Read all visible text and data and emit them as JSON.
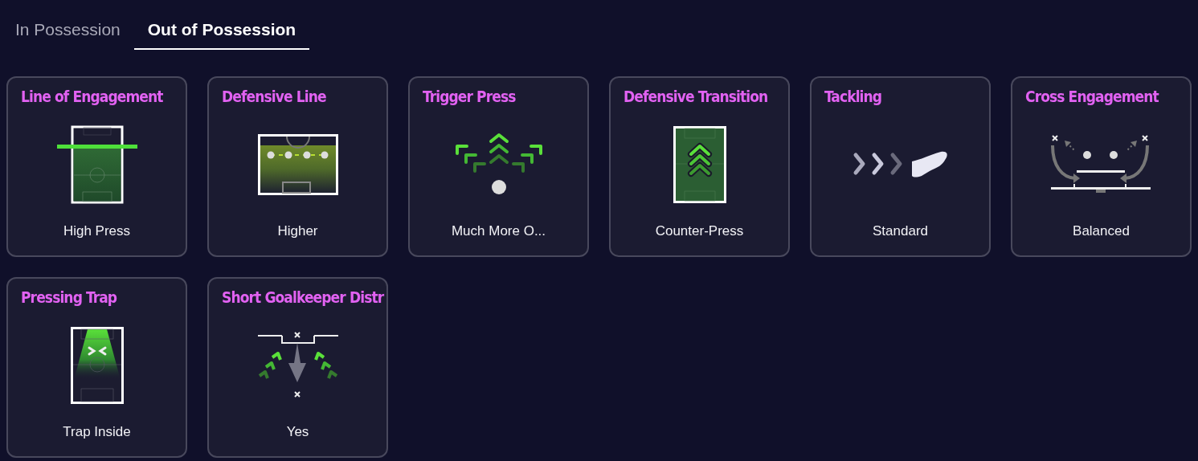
{
  "tabs": [
    {
      "label": "In Possession",
      "selected": false
    },
    {
      "label": "Out of Possession",
      "selected": true
    }
  ],
  "cards": [
    {
      "title": "Line of Engagement",
      "value": "High Press",
      "kind": "engagement"
    },
    {
      "title": "Defensive Line",
      "value": "Higher",
      "kind": "defline"
    },
    {
      "title": "Trigger Press",
      "value": "Much More O...",
      "kind": "trigger"
    },
    {
      "title": "Defensive Transition",
      "value": "Counter-Press",
      "kind": "transition"
    },
    {
      "title": "Tackling",
      "value": "Standard",
      "kind": "tackling"
    },
    {
      "title": "Cross Engagement",
      "value": "Balanced",
      "kind": "cross"
    },
    {
      "title": "Pressing Trap",
      "value": "Trap Inside",
      "kind": "trap"
    },
    {
      "title": "Short Goalkeeper Distr",
      "value": "Yes",
      "kind": "gk"
    }
  ]
}
